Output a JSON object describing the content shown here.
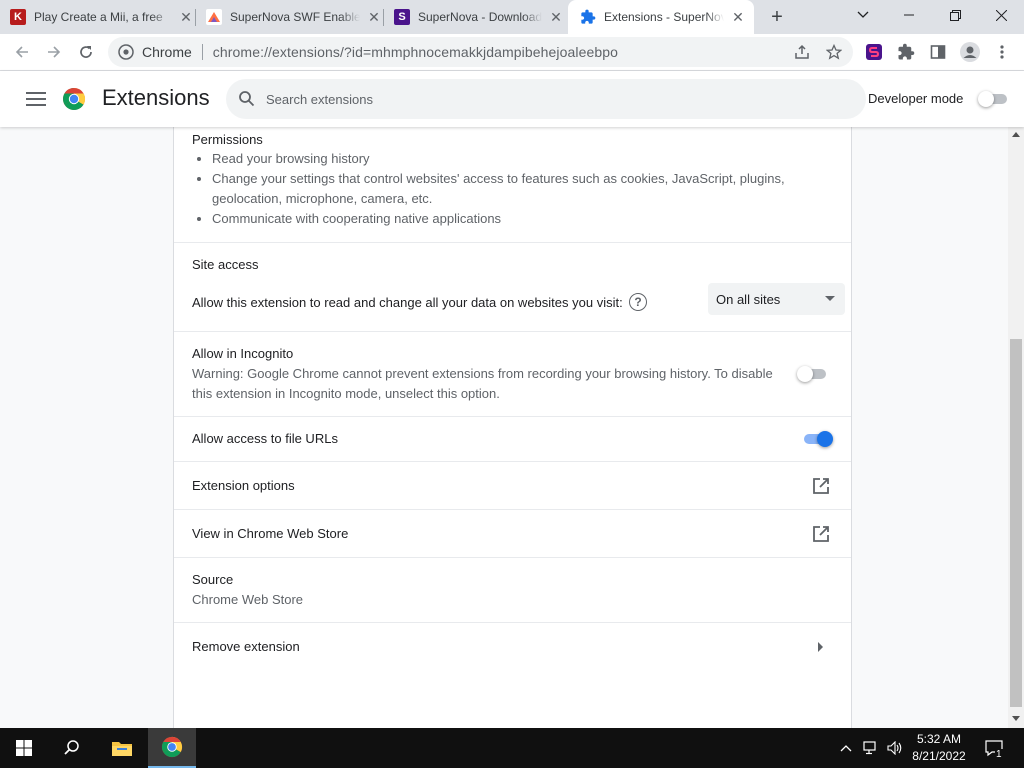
{
  "tabs": [
    {
      "title": "Play Create a Mii, a free",
      "favicon": "k-logo-icon",
      "color": "#b71c1c",
      "active": false
    },
    {
      "title": "SuperNova SWF Enabler",
      "favicon": "supernova-swf-icon",
      "color": "#ff7043",
      "active": false
    },
    {
      "title": "SuperNova - Download",
      "favicon": "supernova-icon",
      "color": "#7b1fa2",
      "active": false
    },
    {
      "title": "Extensions - SuperNova",
      "favicon": "puzzle-icon",
      "color": "#1a73e8",
      "active": true
    }
  ],
  "omnibox": {
    "site_label": "Chrome",
    "url": "chrome://extensions/?id=mhmphnocemakkjdampibehejoaleebpo"
  },
  "header": {
    "title": "Extensions",
    "search_placeholder": "Search extensions",
    "developer_mode_label": "Developer mode",
    "developer_mode_on": false
  },
  "permissions": {
    "heading": "Permissions",
    "items": [
      "Read your browsing history",
      "Change your settings that control websites' access to features such as cookies, JavaScript, plugins, geolocation, microphone, camera, etc.",
      "Communicate with cooperating native applications"
    ]
  },
  "site_access": {
    "heading": "Site access",
    "description": "Allow this extension to read and change all your data on websites you visit:",
    "selected": "On all sites"
  },
  "incognito": {
    "heading": "Allow in Incognito",
    "warning": "Warning: Google Chrome cannot prevent extensions from recording your browsing history. To disable this extension in Incognito mode, unselect this option.",
    "enabled": false
  },
  "file_urls": {
    "label": "Allow access to file URLs",
    "enabled": true
  },
  "extension_options": {
    "label": "Extension options"
  },
  "web_store": {
    "label": "View in Chrome Web Store"
  },
  "source": {
    "heading": "Source",
    "value": "Chrome Web Store"
  },
  "remove": {
    "label": "Remove extension"
  },
  "taskbar": {
    "time": "5:32 AM",
    "date": "8/21/2022",
    "notification_count": "1"
  },
  "colors": {
    "accent": "#1a73e8",
    "taskbar": "#101010"
  }
}
